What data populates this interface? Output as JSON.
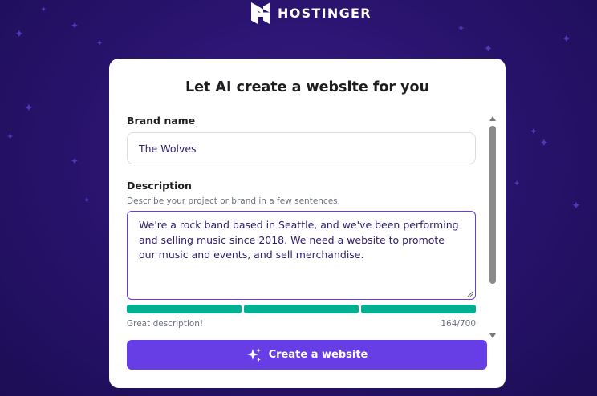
{
  "brand": {
    "name": "HOSTINGER",
    "logo_icon": "hostinger-logo-icon"
  },
  "card": {
    "title": "Let AI create a website for you",
    "brand_name": {
      "label": "Brand name",
      "value": "The Wolves"
    },
    "description": {
      "label": "Description",
      "helper": "Describe your project or brand in a few sentences.",
      "value": "We're a rock band based in Seattle, and we've been performing and selling music since 2018. We need a website to promote our music and events, and sell merchandise.",
      "quality_text": "Great description!",
      "char_count": "164/700",
      "quality_segments_filled": 3,
      "quality_segments_total": 3
    },
    "cta": {
      "label": "Create a website",
      "icon": "sparkles-icon"
    }
  },
  "colors": {
    "accent": "#673de6",
    "success": "#00b090",
    "background": "#2a1470"
  }
}
